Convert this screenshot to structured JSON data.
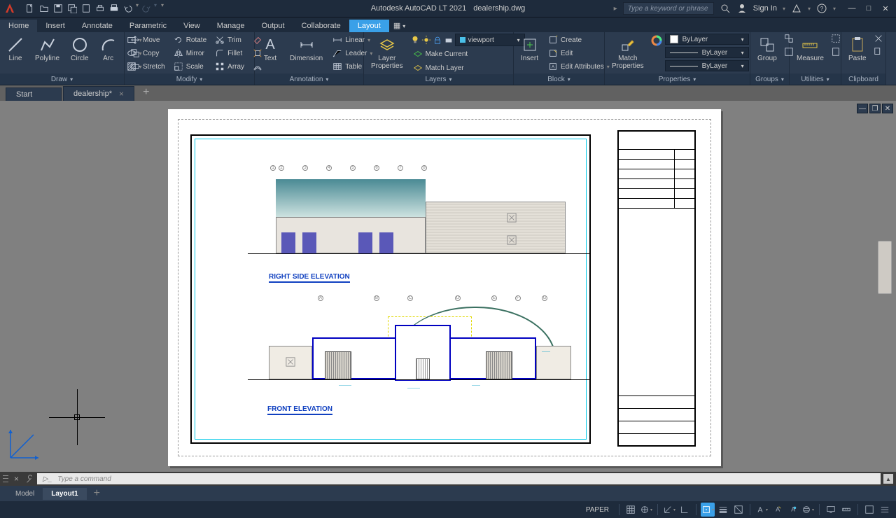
{
  "title": {
    "app": "Autodesk AutoCAD LT 2021",
    "file": "dealership.dwg"
  },
  "search": {
    "placeholder": "Type a keyword or phrase"
  },
  "signin": "Sign In",
  "ribbon_tabs": [
    "Home",
    "Insert",
    "Annotate",
    "Parametric",
    "View",
    "Manage",
    "Output",
    "Collaborate",
    "Layout"
  ],
  "panels": {
    "draw": {
      "title": "Draw",
      "line": "Line",
      "polyline": "Polyline",
      "circle": "Circle",
      "arc": "Arc"
    },
    "modify": {
      "title": "Modify",
      "move": "Move",
      "rotate": "Rotate",
      "trim": "Trim",
      "copy": "Copy",
      "mirror": "Mirror",
      "fillet": "Fillet",
      "stretch": "Stretch",
      "scale": "Scale",
      "array": "Array"
    },
    "annotation": {
      "title": "Annotation",
      "text": "Text",
      "dimension": "Dimension",
      "linear": "Linear",
      "leader": "Leader",
      "table": "Table"
    },
    "layers": {
      "title": "Layers",
      "props": "Layer\nProperties",
      "make_current": "Make Current",
      "match": "Match Layer",
      "dd_value": "viewport"
    },
    "block": {
      "title": "Block",
      "insert": "Insert",
      "create": "Create",
      "edit": "Edit",
      "edit_attr": "Edit Attributes"
    },
    "properties": {
      "title": "Properties",
      "match": "Match\nProperties",
      "layer": "ByLayer",
      "line1": "ByLayer",
      "line2": "ByLayer"
    },
    "groups": {
      "title": "Groups",
      "group": "Group"
    },
    "utilities": {
      "title": "Utilities",
      "measure": "Measure"
    },
    "clipboard": {
      "title": "Clipboard",
      "paste": "Paste"
    }
  },
  "doc_tabs": {
    "start": "Start",
    "file": "dealership*"
  },
  "drawing": {
    "label1": "RIGHT SIDE ELEVATION",
    "label2": "FRONT ELEVATION",
    "grids1": [
      "1",
      "2",
      "3",
      "4",
      "5",
      "6",
      "7",
      "8"
    ],
    "grids2": [
      "A",
      "B",
      "C",
      "D",
      "E",
      "F",
      "G"
    ]
  },
  "command": {
    "placeholder": "Type a command"
  },
  "layout_tabs": {
    "model": "Model",
    "layout1": "Layout1"
  },
  "status": {
    "space": "PAPER"
  }
}
